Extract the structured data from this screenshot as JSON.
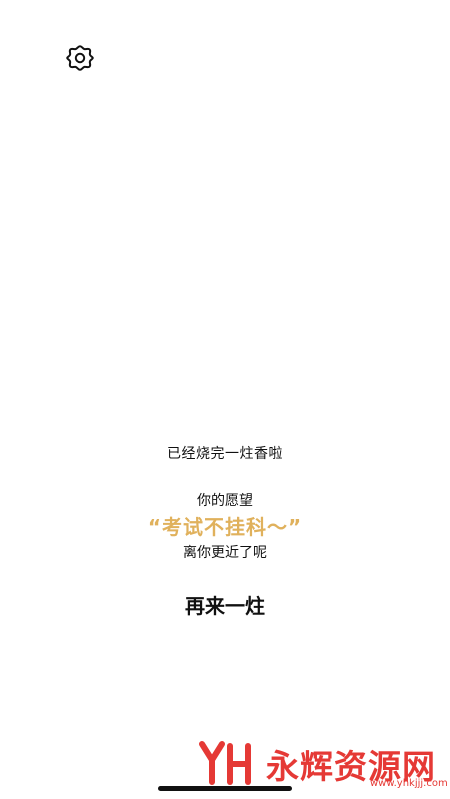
{
  "settings": {
    "icon": "gear-icon"
  },
  "message": {
    "done": "已经烧完一炷香啦",
    "wish_label": "你的愿望",
    "wish": "“考试不挂科～”",
    "closer": "离你更近了呢"
  },
  "actions": {
    "again": "再来一炷"
  },
  "watermark": {
    "brand": "永辉资源网",
    "url": "www.yhkjjj.com",
    "color": "#e53935"
  },
  "colors": {
    "wish": "#e0b15c",
    "text": "#111111",
    "background": "#ffffff"
  }
}
